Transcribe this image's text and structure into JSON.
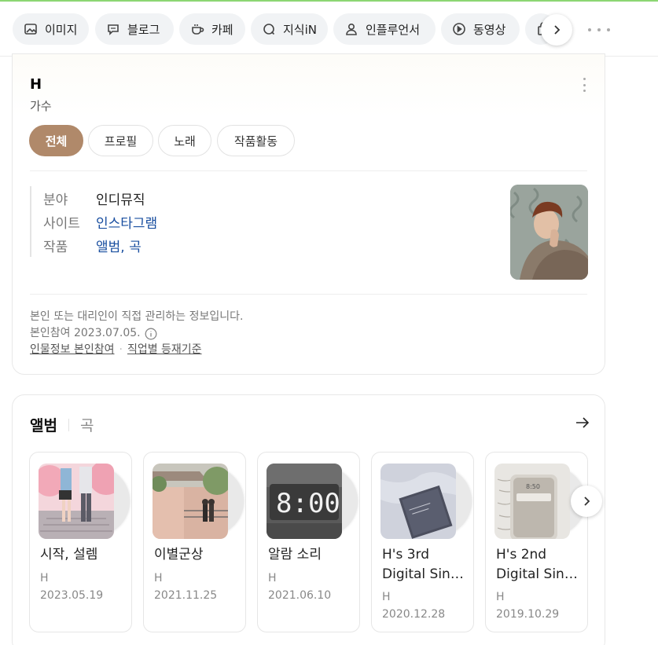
{
  "tabs": [
    {
      "label": "이미지",
      "icon": "image-icon"
    },
    {
      "label": "블로그",
      "icon": "blog-icon"
    },
    {
      "label": "카페",
      "icon": "cafe-icon"
    },
    {
      "label": "지식iN",
      "icon": "kin-icon"
    },
    {
      "label": "인플루언서",
      "icon": "influencer-icon"
    },
    {
      "label": "동영상",
      "icon": "video-icon"
    },
    {
      "label": "",
      "icon": "shopping-icon"
    }
  ],
  "profile": {
    "name": "H",
    "job": "가수",
    "tabs": [
      "전체",
      "프로필",
      "노래",
      "작품활동"
    ],
    "active_tab": "전체",
    "info": [
      {
        "key": "분야",
        "value": "인디뮤직",
        "link": false
      },
      {
        "key": "사이트",
        "value": "인스타그램",
        "link": true
      },
      {
        "key": "작품",
        "value": "앨범, 곡",
        "link": true
      }
    ],
    "notice_line1": "본인 또는 대리인이 직접 관리하는 정보입니다.",
    "notice_line2": "본인참여 2023.07.05.",
    "link1": "인물정보 본인참여",
    "link2": "직업별 등재기준"
  },
  "albums_section": {
    "tab_active": "앨범",
    "tab_other": "곡",
    "items": [
      {
        "title": [
          "시작, 설렘"
        ],
        "artist": "H",
        "date": "2023.05.19"
      },
      {
        "title": [
          "이별군상"
        ],
        "artist": "H",
        "date": "2021.11.25"
      },
      {
        "title": [
          "알람 소리"
        ],
        "artist": "H",
        "date": "2021.06.10"
      },
      {
        "title": [
          "H's 3rd",
          "Digital Sing..."
        ],
        "artist": "H",
        "date": "2020.12.28"
      },
      {
        "title": [
          "H's 2nd",
          "Digital Sing..."
        ],
        "artist": "H",
        "date": "2019.10.29"
      }
    ]
  },
  "colors": {
    "accent": "#b0896a",
    "link": "#1a4fa0",
    "topline": "#2db400"
  }
}
